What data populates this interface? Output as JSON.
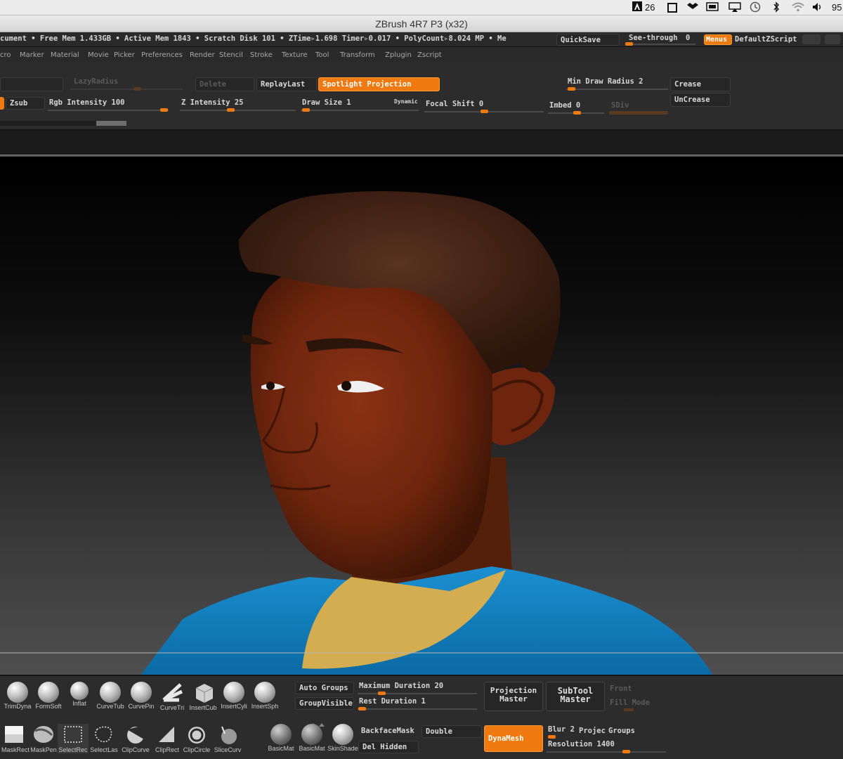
{
  "system_bar": {
    "adobe_count": "26",
    "battery_text": "95"
  },
  "window": {
    "title": "ZBrush 4R7 P3 (x32)"
  },
  "status": {
    "text": "cument  • Free Mem 1.433GB • Active Mem 1843 • Scratch Disk 101 • ZTime▹1.698 Timer▹0.017 • PolyCount▹8.024 MP  • Me",
    "quicksave": "QuickSave",
    "see_through_label": "See-through",
    "see_through_value": "0",
    "menus": "Menus",
    "default_zscript": "DefaultZScript"
  },
  "palettes": [
    "cro",
    "Marker",
    "Material",
    "Movie",
    "Picker",
    "Preferences",
    "Render",
    "Stencil",
    "Stroke",
    "Texture",
    "Tool",
    "Transform",
    "Zplugin",
    "Zscript"
  ],
  "top_shelf": {
    "lazy_radius": "LazyRadius",
    "delete": "Delete",
    "replay_last": "ReplayLast",
    "spotlight_projection": "Spotlight Projection",
    "min_draw_radius": "Min Draw Radius 2",
    "crease": "Crease",
    "uncrease": "UnCrease",
    "zsub": "Zsub",
    "rgb_intensity": "Rgb Intensity 100",
    "z_intensity": "Z Intensity 25",
    "draw_size": "Draw Size 1",
    "dynamic": "Dynamic",
    "focal_shift": "Focal Shift 0",
    "imbed": "Imbed 0",
    "sdiv": "SDiv"
  },
  "controls": {
    "rgb_intensity": 100,
    "z_intensity": 25,
    "draw_size": 1,
    "focal_shift": 0,
    "imbed": 0,
    "min_draw_radius": 2
  },
  "bottom_shelf": {
    "brushes": [
      {
        "label": "TrimDyna",
        "icon": "trim-dynamic-brush-icon"
      },
      {
        "label": "FormSoft",
        "icon": "form-soft-brush-icon"
      },
      {
        "label": "Inflat",
        "icon": "inflate-brush-icon"
      },
      {
        "label": "CurveTub",
        "icon": "curve-tube-brush-icon"
      },
      {
        "label": "CurvePin",
        "icon": "curve-pinch-brush-icon"
      },
      {
        "label": "CurveTri",
        "icon": "curve-triangle-brush-icon"
      },
      {
        "label": "InsertCub",
        "icon": "insert-cube-brush-icon"
      },
      {
        "label": "InsertCyli",
        "icon": "insert-cylinder-brush-icon"
      },
      {
        "label": "InsertSph",
        "icon": "insert-sphere-brush-icon"
      }
    ],
    "row2": [
      {
        "label": "MaskRect",
        "icon": "mask-rect-icon"
      },
      {
        "label": "MaskPen",
        "icon": "mask-pen-icon"
      },
      {
        "label": "SelectRec",
        "icon": "select-rect-icon"
      },
      {
        "label": "SelectLas",
        "icon": "select-lasso-icon"
      },
      {
        "label": "ClipCurve",
        "icon": "clip-curve-icon"
      },
      {
        "label": "ClipRect",
        "icon": "clip-rect-icon"
      },
      {
        "label": "ClipCircle",
        "icon": "clip-circle-icon"
      },
      {
        "label": "SliceCurv",
        "icon": "slice-curve-icon"
      }
    ],
    "materials": [
      {
        "label": "BasicMat",
        "icon": "basic-material-icon"
      },
      {
        "label": "BasicMat",
        "icon": "basic-material-2-icon"
      },
      {
        "label": "SkinShade",
        "icon": "skin-shade-icon"
      }
    ],
    "auto_groups": "Auto Groups",
    "group_visible": "GroupVisible",
    "max_duration": "Maximum Duration 20",
    "rest_duration": "Rest Duration 1",
    "projection_master": [
      "Projection",
      "Master"
    ],
    "subtool_master": [
      "SubTool",
      "Master"
    ],
    "front": "Front",
    "fill_mode": "Fill Mode",
    "backface_mask": "BackfaceMask",
    "double": "Double",
    "del_hidden": "Del Hidden",
    "dynamesh": "DynaMesh",
    "blur": "Blur 2",
    "project": "Projec",
    "groups": "Groups",
    "resolution": "Resolution 1400"
  },
  "colors": {
    "accent": "#f07a10",
    "skin": "#7a2a10",
    "hair": "#3a1d10",
    "shirt": "#0f82c0",
    "undershirt": "#d4ad50"
  }
}
